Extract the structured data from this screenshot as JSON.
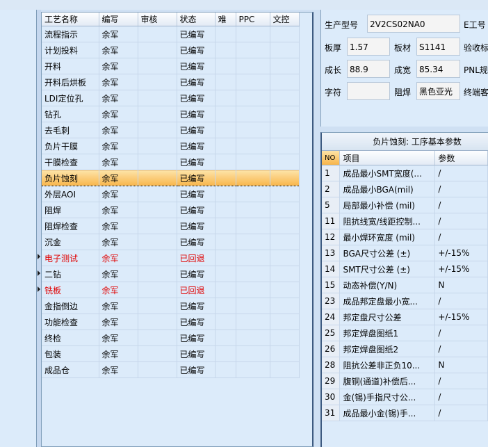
{
  "process_grid": {
    "columns": [
      "工艺名称",
      "编写",
      "审核",
      "状态",
      "难",
      "PPC",
      "文控"
    ],
    "rows": [
      {
        "name": "流程指示",
        "writer": "余军",
        "reviewer": "",
        "status": "已编写"
      },
      {
        "name": "计划投料",
        "writer": "余军",
        "reviewer": "",
        "status": "已编写"
      },
      {
        "name": "开料",
        "writer": "余军",
        "reviewer": "",
        "status": "已编写"
      },
      {
        "name": "开料后烘板",
        "writer": "余军",
        "reviewer": "",
        "status": "已编写"
      },
      {
        "name": "LDI定位孔",
        "writer": "余军",
        "reviewer": "",
        "status": "已编写"
      },
      {
        "name": "钻孔",
        "writer": "余军",
        "reviewer": "",
        "status": "已编写"
      },
      {
        "name": "去毛刺",
        "writer": "余军",
        "reviewer": "",
        "status": "已编写"
      },
      {
        "name": "负片干膜",
        "writer": "余军",
        "reviewer": "",
        "status": "已编写"
      },
      {
        "name": "干膜检查",
        "writer": "余军",
        "reviewer": "",
        "status": "已编写"
      },
      {
        "name": "负片蚀刻",
        "writer": "余军",
        "reviewer": "",
        "status": "已编写"
      },
      {
        "name": "外层AOI",
        "writer": "余军",
        "reviewer": "",
        "status": "已编写"
      },
      {
        "name": "阻焊",
        "writer": "余军",
        "reviewer": "",
        "status": "已编写"
      },
      {
        "name": "阻焊检查",
        "writer": "余军",
        "reviewer": "",
        "status": "已编写"
      },
      {
        "name": "沉金",
        "writer": "余军",
        "reviewer": "",
        "status": "已编写"
      },
      {
        "name": "电子测试",
        "writer": "余军",
        "reviewer": "",
        "status": "已回退"
      },
      {
        "name": "二钻",
        "writer": "余军",
        "reviewer": "",
        "status": "已编写"
      },
      {
        "name": "铣板",
        "writer": "余军",
        "reviewer": "",
        "status": "已回退"
      },
      {
        "name": "金指倒边",
        "writer": "余军",
        "reviewer": "",
        "status": "已编写"
      },
      {
        "name": "功能检查",
        "writer": "余军",
        "reviewer": "",
        "status": "已编写"
      },
      {
        "name": "终检",
        "writer": "余军",
        "reviewer": "",
        "status": "已编写"
      },
      {
        "name": "包装",
        "writer": "余军",
        "reviewer": "",
        "status": "已编写"
      },
      {
        "name": "成品仓",
        "writer": "余军",
        "reviewer": "",
        "status": "已编写"
      }
    ],
    "selected_index": 9,
    "returned_rows": [
      14,
      16
    ],
    "colors": {
      "selected": "#f8b54a",
      "returned": "#e00000"
    }
  },
  "product_form": {
    "model_label": "生产型号",
    "model_value": "2V2CS02NA0",
    "e_label": "E工号",
    "thickness_label": "板厚",
    "thickness_value": "1.57",
    "material_label": "板材",
    "material_value": "S1141",
    "acceptance_label": "验收标",
    "length_label": "成长",
    "length_value": "88.9",
    "width_label": "成宽",
    "width_value": "85.34",
    "pnl_label": "PNL规",
    "char_label": "字符",
    "char_value": "",
    "mask_label": "阻焊",
    "mask_value": "黑色亚光",
    "end_label": "终端客"
  },
  "params_panel": {
    "title": "负片蚀刻: 工序基本参数",
    "columns": {
      "no": "NO",
      "item": "项目",
      "param": "参数"
    },
    "rows": [
      {
        "no": "1",
        "item": "成品最小SMT宽度(...",
        "param": "/"
      },
      {
        "no": "2",
        "item": "成品最小BGA(mil)",
        "param": "/"
      },
      {
        "no": "5",
        "item": "局部最小补偿 (mil)",
        "param": "/"
      },
      {
        "no": "11",
        "item": "阻抗线宽/线距控制...",
        "param": "/"
      },
      {
        "no": "12",
        "item": "最小焊环宽度 (mil)",
        "param": "/"
      },
      {
        "no": "13",
        "item": "BGA尺寸公差 (±)",
        "param": "+/-15%"
      },
      {
        "no": "14",
        "item": "SMT尺寸公差 (±)",
        "param": "+/-15%"
      },
      {
        "no": "15",
        "item": "动态补偿(Y/N)",
        "param": "N"
      },
      {
        "no": "23",
        "item": "成品邦定盘最小宽...",
        "param": "/"
      },
      {
        "no": "24",
        "item": "邦定盘尺寸公差",
        "param": "+/-15%"
      },
      {
        "no": "25",
        "item": "邦定焊盘图纸1",
        "param": "/"
      },
      {
        "no": "26",
        "item": "邦定焊盘图纸2",
        "param": "/"
      },
      {
        "no": "28",
        "item": "阻抗公差非正负10...",
        "param": "N"
      },
      {
        "no": "29",
        "item": "腹铜(通道)补偿后...",
        "param": "/"
      },
      {
        "no": "30",
        "item": "金(锡)手指尺寸公...",
        "param": "/"
      },
      {
        "no": "31",
        "item": "成品最小金(锡)手...",
        "param": "/"
      }
    ]
  }
}
